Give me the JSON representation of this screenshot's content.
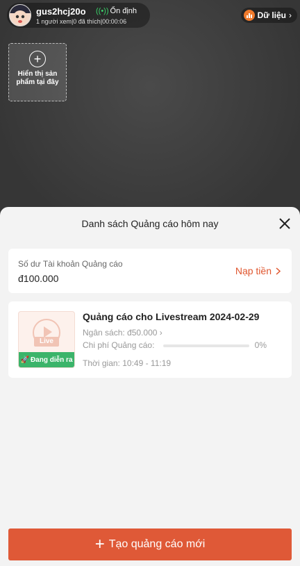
{
  "live": {
    "host_name": "gus2hcj20o",
    "status": "Ổn định",
    "stats": "1 người xem|0 đã thích|00:00:06",
    "data_button": "Dữ liệu",
    "product_placeholder": "Hiển thị sản phẩm tại đây"
  },
  "sheet": {
    "title": "Danh sách Quảng cáo hôm nay",
    "balance": {
      "label": "Số dư Tài khoản Quảng cáo",
      "value": "đ100.000",
      "topup_label": "Nạp tiền"
    },
    "ad": {
      "thumb_live_label": "Live",
      "status": "Đang diễn ra",
      "title": "Quảng cáo cho Livestream 2024-02-29",
      "budget": "Ngân sách: đ50.000",
      "cost_label": "Chi phí Quảng cáo:",
      "cost_percent": "0%",
      "cost_progress": 0,
      "time": "Thời gian: 10:49 - 11:19"
    },
    "create_button": "Tạo quảng cáo mới"
  },
  "colors": {
    "accent": "#df5937",
    "status_green": "#3bb46a",
    "signal_green": "#3ad36a"
  },
  "icons": [
    "avatar",
    "signal-icon",
    "bar-chart-icon",
    "chevron-right-icon",
    "plus-circle-icon",
    "close-icon",
    "play-icon",
    "rocket-icon",
    "plus-icon"
  ]
}
